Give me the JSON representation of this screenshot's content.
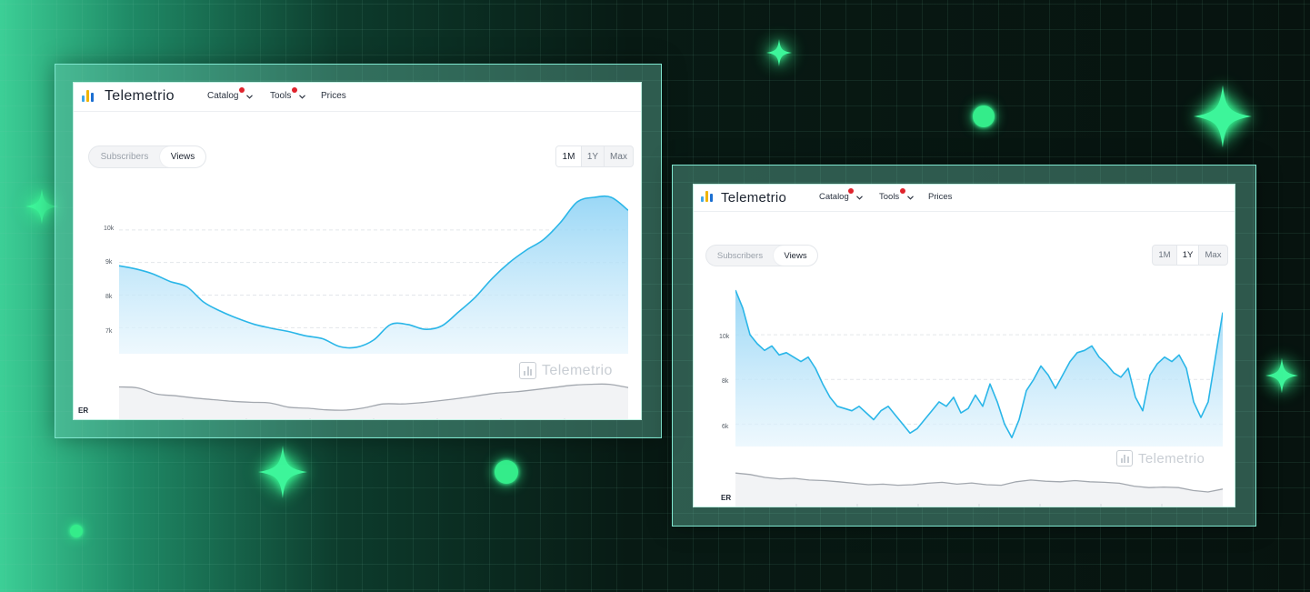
{
  "colors": {
    "accent_line": "#2ab6e8",
    "er_line": "#a3a8af",
    "logo_bars": [
      "#3fa7ea",
      "#f0b400",
      "#1c6fd1"
    ]
  },
  "icons": [
    "logo-bars-icon",
    "chevron-down-icon",
    "telemetrio-watermark-icon",
    "sparkle-icon"
  ],
  "screens": [
    {
      "brand": "Telemetrio",
      "nav": [
        {
          "label": "Catalog",
          "has_dropdown": true,
          "badge": true
        },
        {
          "label": "Tools",
          "has_dropdown": true,
          "badge": true
        },
        {
          "label": "Prices",
          "has_dropdown": false,
          "badge": false
        }
      ],
      "metric_tabs": [
        {
          "label": "Subscribers",
          "active": false
        },
        {
          "label": "Views",
          "active": true
        }
      ],
      "range_tabs": [
        {
          "label": "1M",
          "active": true
        },
        {
          "label": "1Y",
          "active": false
        },
        {
          "label": "Max",
          "active": false
        }
      ],
      "watermark": "Telemetrio",
      "er_label": "ER",
      "y_ticks": [
        "10k",
        "9k",
        "8k",
        "7k"
      ]
    },
    {
      "brand": "Telemetrio",
      "nav": [
        {
          "label": "Catalog",
          "has_dropdown": true,
          "badge": true
        },
        {
          "label": "Tools",
          "has_dropdown": true,
          "badge": true
        },
        {
          "label": "Prices",
          "has_dropdown": false,
          "badge": false
        }
      ],
      "metric_tabs": [
        {
          "label": "Subscribers",
          "active": false
        },
        {
          "label": "Views",
          "active": true
        }
      ],
      "range_tabs": [
        {
          "label": "1M",
          "active": false
        },
        {
          "label": "1Y",
          "active": true
        },
        {
          "label": "Max",
          "active": false
        }
      ],
      "watermark": "Telemetrio",
      "er_label": "ER",
      "y_ticks": [
        "10k",
        "8k",
        "6k"
      ]
    }
  ],
  "chart_data": [
    {
      "type": "area",
      "title": "",
      "xlabel": "",
      "ylabel": "",
      "ylim": [
        6200,
        11000
      ],
      "y_ticks": [
        10000,
        9000,
        8000,
        7000
      ],
      "series": [
        {
          "values": [
            8900,
            8800,
            8650,
            8420,
            8250,
            7780,
            7500,
            7280,
            7100,
            6980,
            6880,
            6750,
            6660,
            6420,
            6400,
            6620,
            7100,
            7100,
            6950,
            7050,
            7480,
            7940,
            8520,
            9000,
            9380,
            9700,
            10220,
            10860,
            11000,
            11000,
            10600
          ]
        }
      ],
      "er_series": [
        {
          "values": [
            0.82,
            0.79,
            0.6,
            0.55,
            0.48,
            0.43,
            0.38,
            0.35,
            0.33,
            0.2,
            0.17,
            0.12,
            0.11,
            0.18,
            0.3,
            0.3,
            0.34,
            0.4,
            0.47,
            0.55,
            0.63,
            0.67,
            0.73,
            0.8,
            0.87,
            0.9,
            0.9,
            0.8
          ]
        }
      ]
    },
    {
      "type": "area",
      "title": "",
      "xlabel": "",
      "ylabel": "",
      "ylim": [
        5000,
        12000
      ],
      "y_ticks": [
        10000,
        8000,
        6000
      ],
      "series": [
        {
          "values": [
            12000,
            11200,
            10000,
            9600,
            9300,
            9500,
            9100,
            9200,
            9000,
            8800,
            9000,
            8500,
            7800,
            7200,
            6800,
            6700,
            6600,
            6800,
            6500,
            6200,
            6600,
            6800,
            6400,
            6000,
            5600,
            5800,
            6200,
            6600,
            7000,
            6800,
            7200,
            6500,
            6700,
            7300,
            6800,
            7800,
            7000,
            6000,
            5400,
            6200,
            7500,
            8000,
            8600,
            8200,
            7600,
            8200,
            8800,
            9200,
            9300,
            9500,
            9000,
            8700,
            8300,
            8100,
            8500,
            7200,
            6600,
            8200,
            8700,
            9000,
            8800,
            9100,
            8500,
            7000,
            6300,
            7000,
            9000,
            11000
          ]
        }
      ],
      "er_series": [
        {
          "values": [
            0.9,
            0.85,
            0.75,
            0.7,
            0.72,
            0.66,
            0.64,
            0.6,
            0.55,
            0.5,
            0.52,
            0.48,
            0.5,
            0.55,
            0.58,
            0.52,
            0.56,
            0.5,
            0.48,
            0.6,
            0.66,
            0.62,
            0.6,
            0.64,
            0.6,
            0.58,
            0.55,
            0.45,
            0.4,
            0.42,
            0.4,
            0.3,
            0.25,
            0.35
          ]
        }
      ]
    }
  ]
}
